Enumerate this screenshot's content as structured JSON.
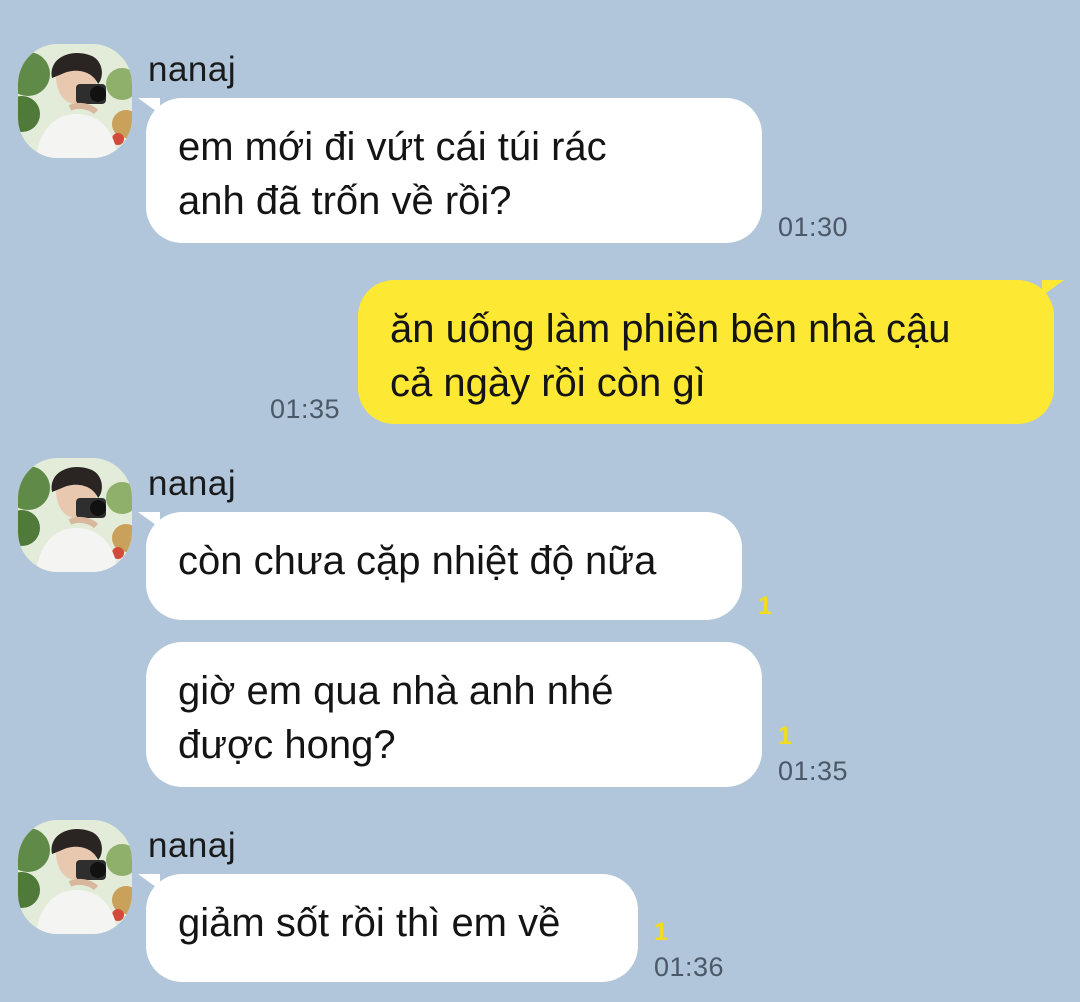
{
  "colors": {
    "background": "#b1c6da",
    "incoming_bubble": "#ffffff",
    "outgoing_bubble": "#fde934",
    "unread_count": "#f3db1f",
    "timestamp": "#4a5868"
  },
  "messages": [
    {
      "direction": "incoming",
      "sender": "nanaj",
      "avatar": "user-avatar-photo",
      "lines": [
        "em mới đi vứt cái túi rác",
        "anh đã trốn về rồi?"
      ],
      "time": "01:30"
    },
    {
      "direction": "outgoing",
      "lines": [
        "ăn uống làm phiền bên nhà cậu",
        "cả ngày rồi còn gì"
      ],
      "time": "01:35"
    },
    {
      "direction": "incoming",
      "sender": "nanaj",
      "avatar": "user-avatar-photo",
      "lines": [
        "còn chưa cặp nhiệt độ nữa"
      ],
      "unread": "1"
    },
    {
      "direction": "incoming",
      "lines": [
        "giờ em qua nhà anh nhé",
        "được hong?"
      ],
      "unread": "1",
      "time": "01:35"
    },
    {
      "direction": "incoming",
      "sender": "nanaj",
      "avatar": "user-avatar-photo",
      "lines": [
        "giảm sốt rồi thì em về"
      ],
      "unread": "1",
      "time": "01:36"
    }
  ]
}
